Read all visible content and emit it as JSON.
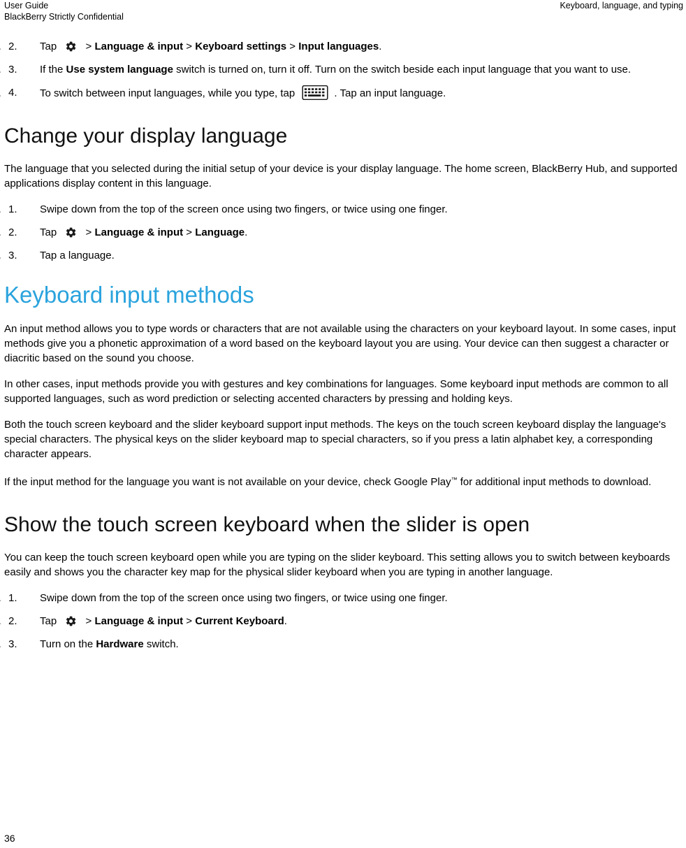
{
  "header": {
    "left_line1": "User Guide",
    "left_line2": "BlackBerry Strictly Confidential",
    "right": "Keyboard, language, and typing"
  },
  "steps_top": [
    {
      "num": "2.",
      "parts": [
        {
          "t": "text",
          "v": "Tap "
        },
        {
          "t": "icon",
          "v": "gear-icon"
        },
        {
          "t": "text",
          "v": " > "
        },
        {
          "t": "bold",
          "v": "Language & input"
        },
        {
          "t": "text",
          "v": " > "
        },
        {
          "t": "bold",
          "v": "Keyboard settings"
        },
        {
          "t": "text",
          "v": " > "
        },
        {
          "t": "bold",
          "v": "Input languages"
        },
        {
          "t": "text",
          "v": "."
        }
      ]
    },
    {
      "num": "3.",
      "parts": [
        {
          "t": "text",
          "v": "If the "
        },
        {
          "t": "bold",
          "v": "Use system language"
        },
        {
          "t": "text",
          "v": " switch is turned on, turn it off. Turn on the switch beside each input language that you want to use."
        }
      ]
    },
    {
      "num": "4.",
      "parts": [
        {
          "t": "text",
          "v": "To switch between input languages, while you type, tap "
        },
        {
          "t": "icon",
          "v": "keyboard-icon"
        },
        {
          "t": "text",
          "v": ". Tap an input language."
        }
      ]
    }
  ],
  "section_display": {
    "heading": "Change your display language",
    "intro": "The language that you selected during the initial setup of your device is your display language. The home screen, BlackBerry Hub, and supported applications display content in this language.",
    "steps": [
      {
        "num": "1.",
        "parts": [
          {
            "t": "text",
            "v": "Swipe down from the top of the screen once using two fingers, or twice using one finger."
          }
        ]
      },
      {
        "num": "2.",
        "parts": [
          {
            "t": "text",
            "v": "Tap "
          },
          {
            "t": "icon",
            "v": "gear-icon"
          },
          {
            "t": "text",
            "v": " > "
          },
          {
            "t": "bold",
            "v": "Language & input"
          },
          {
            "t": "text",
            "v": " > "
          },
          {
            "t": "bold",
            "v": "Language"
          },
          {
            "t": "text",
            "v": "."
          }
        ]
      },
      {
        "num": "3.",
        "parts": [
          {
            "t": "text",
            "v": "Tap a language."
          }
        ]
      }
    ]
  },
  "section_input_methods": {
    "heading": "Keyboard input methods",
    "paragraphs": [
      "An input method allows you to type words or characters that are not available using the characters on your keyboard layout. In some cases, input methods give you a phonetic approximation of a word based on the keyboard layout you are using. Your device can then suggest a character or diacritic based on the sound you choose.",
      "In other cases, input methods provide you with gestures and key combinations for languages. Some keyboard input methods are common to all supported languages, such as word prediction or selecting accented characters by pressing and holding keys.",
      "Both the touch screen keyboard and the slider keyboard support input methods. The keys on the touch screen keyboard display the language's special characters. The physical keys on the slider keyboard map to special characters, so if you press a latin alphabet key, a corresponding character appears."
    ],
    "last_paragraph": {
      "before": "If the input method for the language you want is not available on your device, check Google Play",
      "tm": "™",
      "after": " for additional input methods to download."
    }
  },
  "section_slider": {
    "heading": "Show the touch screen keyboard when the slider is open",
    "intro": "You can keep the touch screen keyboard open while you are typing on the slider keyboard. This setting allows you to switch between keyboards easily and shows you the character key map for the physical slider keyboard when you are typing in another language.",
    "steps": [
      {
        "num": "1.",
        "parts": [
          {
            "t": "text",
            "v": "Swipe down from the top of the screen once using two fingers, or twice using one finger."
          }
        ]
      },
      {
        "num": "2.",
        "parts": [
          {
            "t": "text",
            "v": "Tap "
          },
          {
            "t": "icon",
            "v": "gear-icon"
          },
          {
            "t": "text",
            "v": " > "
          },
          {
            "t": "bold",
            "v": "Language & input"
          },
          {
            "t": "text",
            "v": " > "
          },
          {
            "t": "bold",
            "v": "Current Keyboard"
          },
          {
            "t": "text",
            "v": "."
          }
        ]
      },
      {
        "num": "3.",
        "parts": [
          {
            "t": "text",
            "v": "Turn on the "
          },
          {
            "t": "bold",
            "v": "Hardware"
          },
          {
            "t": "text",
            "v": " switch."
          }
        ]
      }
    ]
  },
  "footer": {
    "page_number": "36"
  },
  "colors": {
    "accent_blue": "#2aa3dd",
    "heading_black": "#111111"
  }
}
